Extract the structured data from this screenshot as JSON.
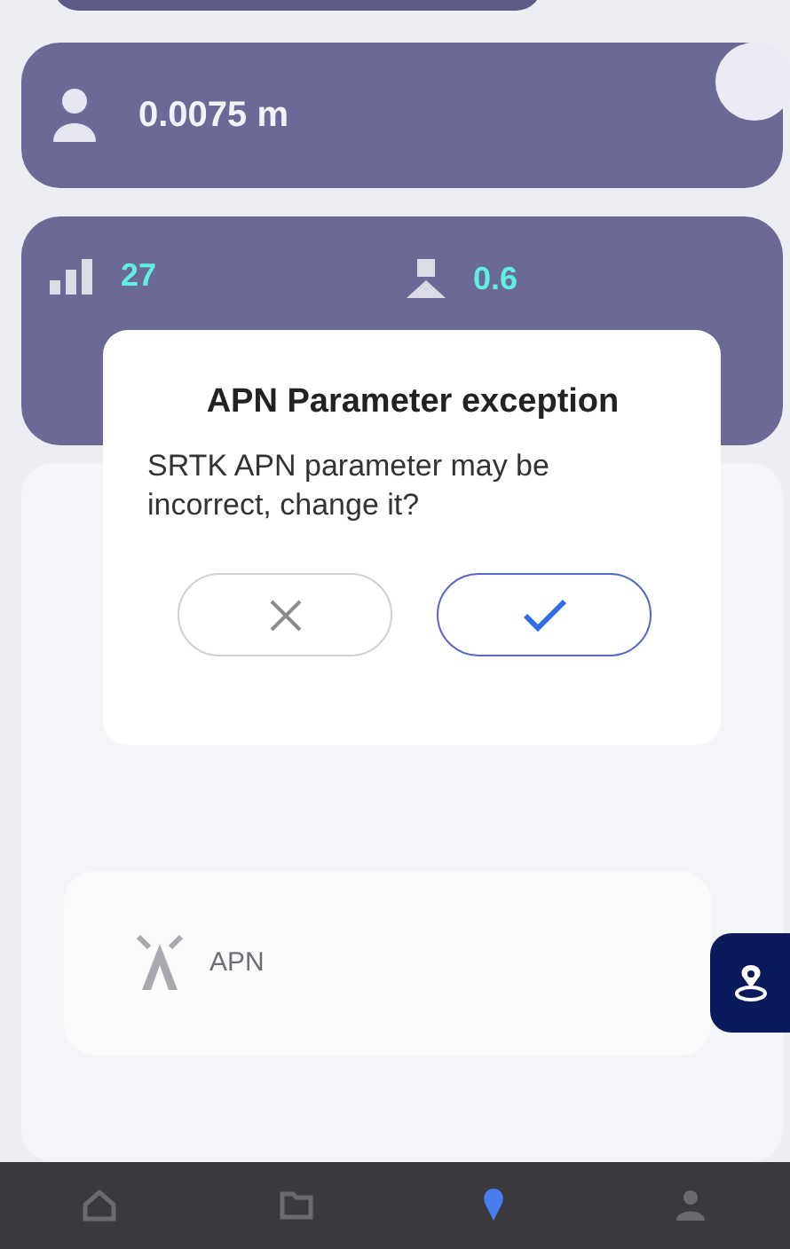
{
  "position_card": {
    "value": "0.0075 m"
  },
  "stats_card": {
    "items": [
      {
        "kind": "signal",
        "value": "27"
      },
      {
        "kind": "satellite",
        "value": "0.6"
      }
    ]
  },
  "apn_card": {
    "label": "APN"
  },
  "dialog": {
    "title": "APN Parameter exception",
    "message": "SRTK APN parameter may be incorrect, change it?",
    "buttons": [
      {
        "kind": "cancel"
      },
      {
        "kind": "confirm"
      }
    ]
  },
  "nav": [
    {
      "kind": "home",
      "selected": false
    },
    {
      "kind": "folder",
      "selected": false
    },
    {
      "kind": "pin",
      "selected": true
    },
    {
      "kind": "person",
      "selected": false
    }
  ]
}
